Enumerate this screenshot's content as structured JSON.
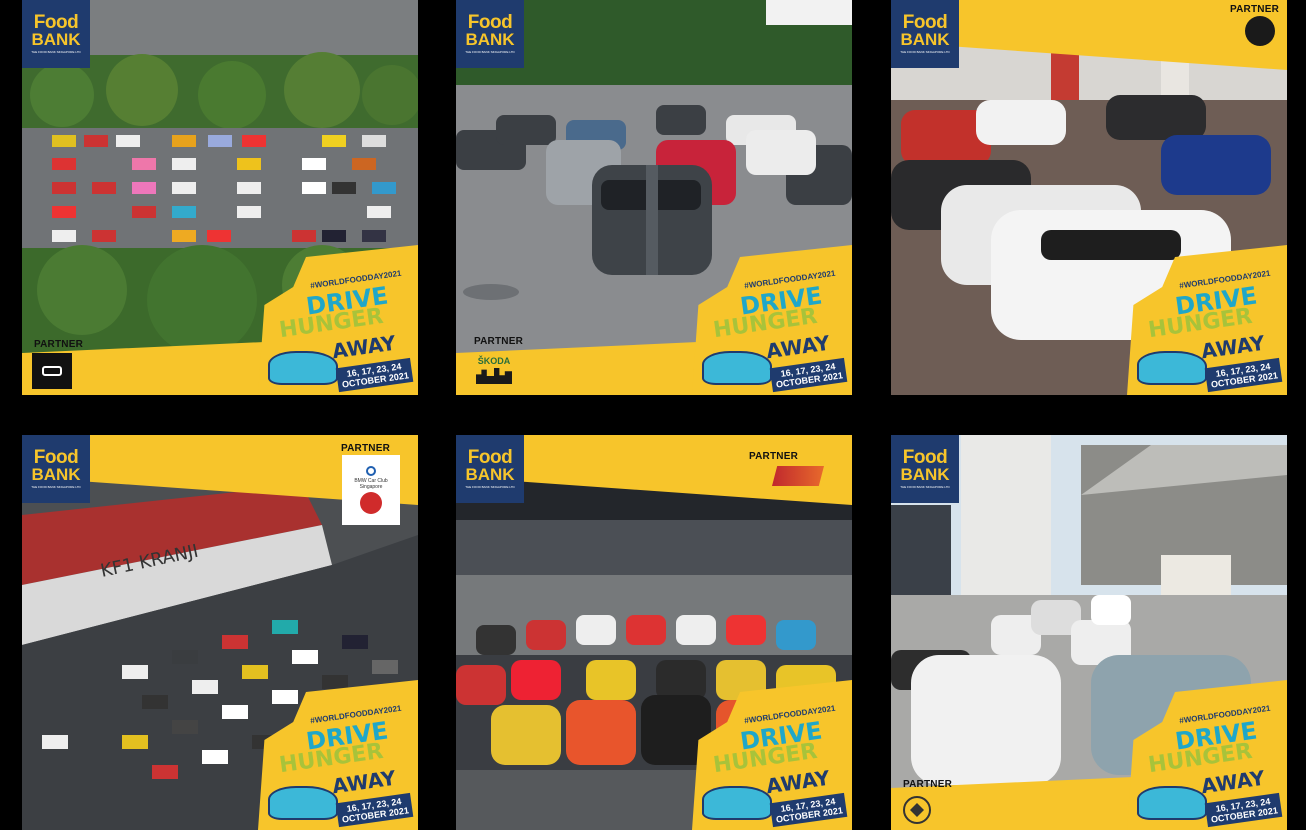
{
  "brand": {
    "logo_line1": "Food",
    "logo_line2": "BANK",
    "logo_sub": "THE FOOD BANK SINGAPORE LTD",
    "yellow": "#f7c52b",
    "navy": "#1f3b6e"
  },
  "badge": {
    "hashtag": "#WORLDFOODDAY2021",
    "line1": "DRIVE",
    "line2": "HUNGER",
    "line3": "AWAY",
    "dates_line1": "16, 17, 23, 24",
    "dates_line2": "OCTOBER 2021"
  },
  "tiles": [
    {
      "partner_label": "PARTNER",
      "partner_name": ""
    },
    {
      "partner_label": "PARTNER",
      "partner_name": "ŠKODA"
    },
    {
      "partner_label": "PARTNER",
      "partner_name": ""
    },
    {
      "partner_label": "PARTNER",
      "partner_name": "BMW Car Club Singapore"
    },
    {
      "partner_label": "PARTNER",
      "partner_name": ""
    },
    {
      "partner_label": "PARTNER",
      "partner_name": ""
    }
  ]
}
